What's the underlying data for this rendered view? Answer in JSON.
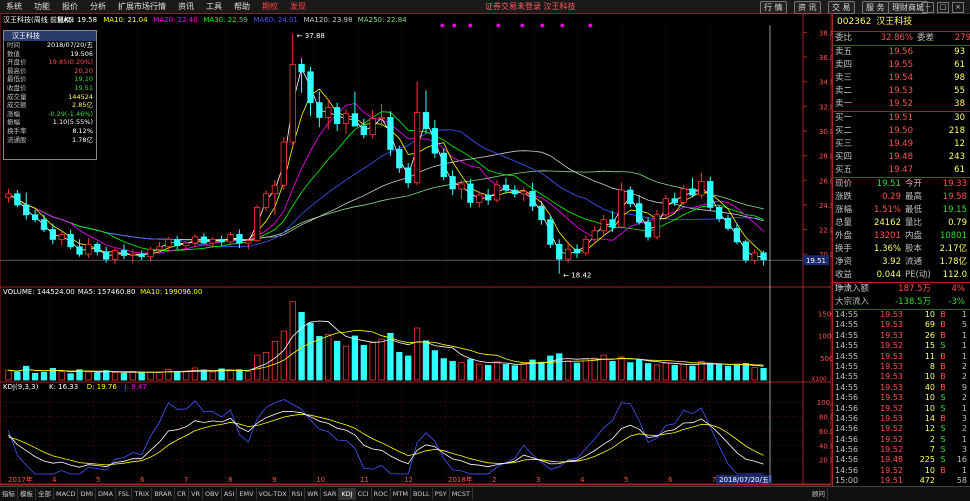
{
  "menubar": {
    "items": [
      "系统",
      "功能",
      "报价",
      "分析",
      "扩展市场行情",
      "资讯",
      "工具",
      "帮助"
    ],
    "highlight_items": [
      "期权",
      "发现"
    ],
    "center_text": "证券交易未登录  汉王科技",
    "right_buttons": [
      "行 情",
      "资 讯",
      "交 易",
      "服 务",
      "理财商城"
    ],
    "window_controls": [
      "－",
      "□",
      "×"
    ]
  },
  "kline_header": {
    "title": "汉王科技(周线 前复权)",
    "ma5": "MA5: 19.58",
    "ma10": "MA10: 21.04",
    "ma20": "MA20: 22.40",
    "ma30": "MA30: 22.59",
    "ma60": "MA60: 24.01",
    "ma120": "MA120: 23.98",
    "ma250": "MA250: 22.84",
    "high_label": "37.88",
    "low_label": "18.42",
    "current_marker": "19.51"
  },
  "volume_header": {
    "title": "VOLUME: 144524.00",
    "ma5": "MA5: 157460.80",
    "ma10": "MA10: 199096.00",
    "unit": "X100"
  },
  "kdj_header": {
    "title": "KDJ(9,3,3)",
    "k": "K: 16.33",
    "d": "D: 19.76",
    "j": "J: 9.47"
  },
  "x_axis": {
    "labels": [
      "2017年",
      "4",
      "5",
      "6",
      "7",
      "8",
      "9",
      "10",
      "11",
      "12",
      "2018年",
      "2",
      "3",
      "4",
      "5",
      "6",
      "7"
    ],
    "current_date": "2018/07/20/五"
  },
  "price_axis": [
    "38.00",
    "36.00",
    "34.00",
    "32.00",
    "30.00",
    "28.00",
    "26.00",
    "24.00",
    "22.00",
    "20.00"
  ],
  "volume_axis": [
    "15000",
    "10000",
    "5000"
  ],
  "kdj_axis": [
    "100.00",
    "80.00",
    "60.00",
    "40.00",
    "20.00"
  ],
  "infobox": {
    "title": "汉王科技",
    "rows": [
      {
        "label": "时间",
        "value": "2018/07/20/五",
        "cls": "white"
      },
      {
        "label": "数值",
        "value": "19.506",
        "cls": "white"
      },
      {
        "label": "开盘价",
        "value": "19.85(0.20%)",
        "cls": "red"
      },
      {
        "label": "最高价",
        "value": "20.20",
        "cls": "red"
      },
      {
        "label": "最低价",
        "value": "19.10",
        "cls": "green"
      },
      {
        "label": "收盘价",
        "value": "19.51",
        "cls": "green"
      },
      {
        "label": "成交量",
        "value": "144524",
        "cls": "yellow"
      },
      {
        "label": "成交额",
        "value": "2.85亿",
        "cls": "yellow"
      },
      {
        "label": "涨幅",
        "value": "-0.29(-1.46%)",
        "cls": "green"
      },
      {
        "label": "振幅",
        "value": "1.10(5.55%)",
        "cls": "white"
      },
      {
        "label": "换手率",
        "value": "8.12%",
        "cls": "white"
      },
      {
        "label": "流通股",
        "value": "1.78亿",
        "cls": "white"
      }
    ]
  },
  "quote": {
    "code": "002362",
    "name": "汉王科技",
    "weibi_label": "委比",
    "weibi": "32.86%",
    "weicha_label": "委差",
    "weicha": "279",
    "sell": [
      {
        "label": "卖五",
        "price": "19.56",
        "vol": "93"
      },
      {
        "label": "卖四",
        "price": "19.55",
        "vol": "61"
      },
      {
        "label": "卖三",
        "price": "19.54",
        "vol": "98"
      },
      {
        "label": "卖二",
        "price": "19.53",
        "vol": "55"
      },
      {
        "label": "卖一",
        "price": "19.52",
        "vol": "38"
      }
    ],
    "buy": [
      {
        "label": "买一",
        "price": "19.51",
        "vol": "30"
      },
      {
        "label": "买二",
        "price": "19.50",
        "vol": "218"
      },
      {
        "label": "买三",
        "price": "19.49",
        "vol": "12"
      },
      {
        "label": "买四",
        "price": "19.48",
        "vol": "243"
      },
      {
        "label": "买五",
        "price": "19.47",
        "vol": "61"
      }
    ],
    "stats": [
      {
        "a": "现价",
        "b": "19.51",
        "bc": "green",
        "c1": "今开",
        "c": "19.33",
        "cc": "red"
      },
      {
        "a": "涨跌",
        "b": "0.29",
        "bc": "red",
        "c1": "最高",
        "c": "19.58",
        "cc": "red"
      },
      {
        "a": "涨幅",
        "b": "1.51%",
        "bc": "red",
        "c1": "最低",
        "c": "19.15",
        "cc": "green"
      },
      {
        "a": "总量",
        "b": "24162",
        "bc": "yellow",
        "c1": "量比",
        "c": "0.79",
        "cc": "yellow"
      },
      {
        "a": "外盘",
        "b": "13201",
        "bc": "red",
        "c1": "内盘",
        "c": "10801",
        "cc": "green"
      },
      {
        "a": "换手",
        "b": "1.36%",
        "bc": "yellow",
        "c1": "股本",
        "c": "2.17亿",
        "cc": "yellow"
      },
      {
        "a": "净资",
        "b": "3.92",
        "bc": "yellow",
        "c1": "流通",
        "c": "1.78亿",
        "cc": "yellow"
      },
      {
        "a": "收益(一)",
        "b": "0.044",
        "bc": "yellow",
        "c1": "PE(动)",
        "c": "112.0",
        "cc": "yellow"
      }
    ],
    "flow": [
      {
        "a": "净流入额",
        "b": "187.5万",
        "c": "4%",
        "bc": "red",
        "cc": "red"
      },
      {
        "a": "大宗流入",
        "b": "-138.5万",
        "c": "-3%",
        "bc": "green",
        "cc": "green"
      }
    ]
  },
  "trades": [
    {
      "t": "14:55",
      "p": "19.53",
      "v": "10",
      "d": "B",
      "n": "1"
    },
    {
      "t": "14:55",
      "p": "19.53",
      "v": "69",
      "d": "B",
      "n": "5"
    },
    {
      "t": "14:55",
      "p": "19.53",
      "v": "26",
      "d": "B",
      "n": "1"
    },
    {
      "t": "14:55",
      "p": "19.52",
      "v": "15",
      "d": "S",
      "n": "1"
    },
    {
      "t": "14:55",
      "p": "19.53",
      "v": "11",
      "d": "B",
      "n": "1"
    },
    {
      "t": "14:55",
      "p": "19.53",
      "v": "8",
      "d": "B",
      "n": "2"
    },
    {
      "t": "14:55",
      "p": "19.53",
      "v": "10",
      "d": "B",
      "n": "2"
    },
    {
      "t": "14:55",
      "p": "19.53",
      "v": "40",
      "d": "B",
      "n": "9"
    },
    {
      "t": "14:56",
      "p": "19.53",
      "v": "10",
      "d": "S",
      "n": "2"
    },
    {
      "t": "14:56",
      "p": "19.52",
      "v": "10",
      "d": "S",
      "n": "1"
    },
    {
      "t": "14:56",
      "p": "19.53",
      "v": "14",
      "d": "B",
      "n": "3"
    },
    {
      "t": "14:56",
      "p": "19.52",
      "v": "12",
      "d": "S",
      "n": "2"
    },
    {
      "t": "14:56",
      "p": "19.52",
      "v": "2",
      "d": "S",
      "n": "1"
    },
    {
      "t": "14:56",
      "p": "19.52",
      "v": "7",
      "d": "S",
      "n": "3"
    },
    {
      "t": "14:56",
      "p": "19.48",
      "v": "225",
      "d": "S",
      "n": "16"
    },
    {
      "t": "14:56",
      "p": "19.52",
      "v": "10",
      "d": "B",
      "n": "1"
    },
    {
      "t": "15:00",
      "p": "19.51",
      "v": "472",
      "d": "",
      "n": "58"
    }
  ],
  "bottombar": {
    "tabs": [
      "指标",
      "模板",
      "全部",
      "MACD",
      "DMI",
      "DMA",
      "FSL",
      "TRIX",
      "BRAR",
      "CR",
      "VR",
      "OBV",
      "ASI",
      "EMV",
      "VOL-TDX",
      "RSI",
      "WR",
      "SAR",
      "KDJ",
      "CCI",
      "ROC",
      "MTM",
      "BOLL",
      "PSY",
      "MCST"
    ],
    "right_tab": "顾问"
  },
  "colors": {
    "up": "#ff3333",
    "down": "#33ffff",
    "ma5": "#ffffff",
    "ma10": "#ffff00",
    "ma20": "#ff00ff",
    "ma30": "#00ff00",
    "ma60": "#4455ff",
    "ma120": "#cccccc",
    "ma250": "#88dd88"
  },
  "chart_data": {
    "type": "candlestick",
    "candles": [
      [
        24.6,
        25.3,
        24.2,
        24.9
      ],
      [
        24.9,
        25.2,
        23.8,
        24.0
      ],
      [
        24.0,
        25.0,
        22.8,
        23.2
      ],
      [
        23.2,
        23.6,
        22.6,
        22.8
      ],
      [
        22.8,
        23.2,
        21.8,
        22.0
      ],
      [
        22.0,
        22.5,
        20.8,
        21.2
      ],
      [
        21.2,
        21.8,
        20.7,
        21.6
      ],
      [
        21.6,
        22.0,
        20.4,
        20.6
      ],
      [
        20.6,
        21.2,
        19.8,
        20.0
      ],
      [
        20.0,
        21.3,
        19.7,
        20.8
      ],
      [
        20.8,
        21.0,
        19.9,
        20.2
      ],
      [
        20.2,
        20.6,
        19.3,
        19.6
      ],
      [
        19.6,
        20.5,
        19.2,
        20.3
      ],
      [
        20.3,
        20.8,
        19.6,
        19.9
      ],
      [
        19.9,
        20.4,
        19.3,
        20.0
      ],
      [
        20.0,
        20.3,
        19.5,
        19.8
      ],
      [
        19.8,
        20.6,
        19.4,
        20.4
      ],
      [
        20.4,
        21.0,
        20.1,
        20.6
      ],
      [
        20.6,
        21.4,
        20.2,
        21.2
      ],
      [
        21.2,
        21.5,
        20.4,
        20.7
      ],
      [
        20.7,
        21.0,
        20.3,
        20.9
      ],
      [
        20.9,
        21.6,
        20.6,
        21.4
      ],
      [
        21.4,
        21.7,
        20.8,
        20.9
      ],
      [
        20.9,
        21.4,
        20.5,
        21.2
      ],
      [
        21.2,
        21.5,
        20.7,
        21.0
      ],
      [
        21.0,
        21.8,
        20.8,
        21.6
      ],
      [
        21.6,
        22.0,
        20.5,
        20.9
      ],
      [
        20.9,
        21.3,
        20.4,
        21.1
      ],
      [
        21.1,
        24.0,
        21.0,
        23.8
      ],
      [
        23.8,
        25.2,
        23.5,
        24.9
      ],
      [
        24.9,
        26.0,
        23.2,
        25.6
      ],
      [
        25.6,
        29.5,
        25.2,
        29.1
      ],
      [
        29.1,
        37.88,
        28.7,
        35.4
      ],
      [
        35.4,
        35.9,
        33.1,
        34.8
      ],
      [
        34.8,
        35.2,
        31.2,
        32.3
      ],
      [
        32.3,
        33.2,
        30.3,
        31.1
      ],
      [
        31.1,
        32.6,
        30.1,
        31.9
      ],
      [
        31.9,
        32.3,
        30.0,
        30.6
      ],
      [
        30.6,
        31.8,
        29.8,
        31.4
      ],
      [
        31.4,
        33.2,
        30.9,
        30.4
      ],
      [
        30.4,
        31.0,
        29.4,
        29.7
      ],
      [
        29.7,
        31.7,
        29.4,
        31.0
      ],
      [
        31.0,
        32.2,
        30.4,
        31.1
      ],
      [
        31.1,
        31.6,
        28.0,
        28.5
      ],
      [
        28.5,
        28.8,
        26.6,
        27.0
      ],
      [
        27.0,
        27.4,
        25.4,
        25.8
      ],
      [
        25.8,
        34.0,
        25.6,
        31.5
      ],
      [
        31.5,
        33.3,
        29.8,
        30.2
      ],
      [
        30.2,
        30.9,
        27.8,
        28.2
      ],
      [
        28.2,
        28.6,
        26.0,
        26.3
      ],
      [
        26.3,
        26.8,
        24.8,
        25.3
      ],
      [
        25.3,
        26.0,
        24.5,
        25.7
      ],
      [
        25.7,
        26.1,
        23.8,
        24.2
      ],
      [
        24.2,
        25.1,
        23.8,
        24.8
      ],
      [
        24.8,
        25.3,
        24.0,
        24.4
      ],
      [
        24.4,
        26.0,
        24.2,
        25.6
      ],
      [
        25.6,
        26.2,
        24.9,
        25.2
      ],
      [
        25.2,
        25.6,
        24.6,
        24.9
      ],
      [
        24.9,
        25.4,
        24.3,
        25.1
      ],
      [
        25.1,
        25.8,
        23.5,
        23.9
      ],
      [
        23.9,
        24.3,
        22.4,
        22.8
      ],
      [
        22.8,
        23.1,
        20.5,
        20.8
      ],
      [
        20.8,
        21.2,
        18.42,
        19.6
      ],
      [
        19.6,
        21.0,
        19.3,
        20.4
      ],
      [
        20.4,
        20.8,
        19.7,
        20.1
      ],
      [
        20.1,
        21.5,
        19.9,
        21.2
      ],
      [
        21.2,
        22.3,
        20.8,
        21.9
      ],
      [
        21.9,
        23.2,
        21.5,
        22.8
      ],
      [
        22.8,
        23.5,
        21.8,
        22.2
      ],
      [
        22.2,
        25.8,
        22.1,
        25.2
      ],
      [
        25.2,
        25.5,
        23.8,
        24.1
      ],
      [
        24.1,
        24.8,
        22.4,
        22.6
      ],
      [
        22.6,
        23.0,
        21.1,
        21.4
      ],
      [
        21.4,
        23.6,
        21.2,
        23.2
      ],
      [
        23.2,
        24.8,
        23.0,
        24.5
      ],
      [
        24.5,
        25.0,
        23.9,
        24.2
      ],
      [
        24.2,
        25.6,
        24.0,
        25.3
      ],
      [
        25.3,
        26.2,
        24.6,
        24.8
      ],
      [
        24.8,
        26.6,
        24.5,
        25.9
      ],
      [
        25.9,
        26.3,
        23.5,
        23.8
      ],
      [
        23.8,
        24.0,
        22.6,
        22.9
      ],
      [
        22.9,
        23.2,
        21.9,
        22.1
      ],
      [
        22.1,
        22.5,
        20.8,
        21.0
      ],
      [
        21.0,
        21.2,
        19.3,
        19.5
      ],
      [
        19.5,
        20.4,
        19.2,
        20.1
      ],
      [
        20.1,
        20.3,
        19.1,
        19.51
      ]
    ],
    "volume_bars": [
      2200,
      1800,
      3100,
      1500,
      1700,
      2600,
      1900,
      1400,
      2300,
      1800,
      1600,
      2100,
      1700,
      1500,
      1900,
      1600,
      1800,
      1700,
      2400,
      1900,
      2000,
      2700,
      2200,
      1800,
      2500,
      2100,
      2300,
      1900,
      5600,
      6200,
      8700,
      11000,
      17600,
      15200,
      12800,
      9800,
      10200,
      8700,
      7600,
      9900,
      7800,
      8400,
      9200,
      10500,
      6200,
      5400,
      11700,
      8800,
      6600,
      4800,
      4200,
      3900,
      4600,
      3600,
      3300,
      4100,
      3500,
      3200,
      3700,
      4500,
      4000,
      5400,
      5900,
      4300,
      3800,
      4700,
      4900,
      5600,
      4200,
      5200,
      3900,
      4600,
      3700,
      3400,
      3800,
      3300,
      3600,
      3100,
      4200,
      3800,
      3400,
      3100,
      3300,
      3700,
      2800,
      2600
    ],
    "volume_ylim": [
      0,
      18000
    ],
    "price_ylim": [
      17.5,
      38.6
    ],
    "kdj_ylim": [
      0,
      110
    ]
  }
}
